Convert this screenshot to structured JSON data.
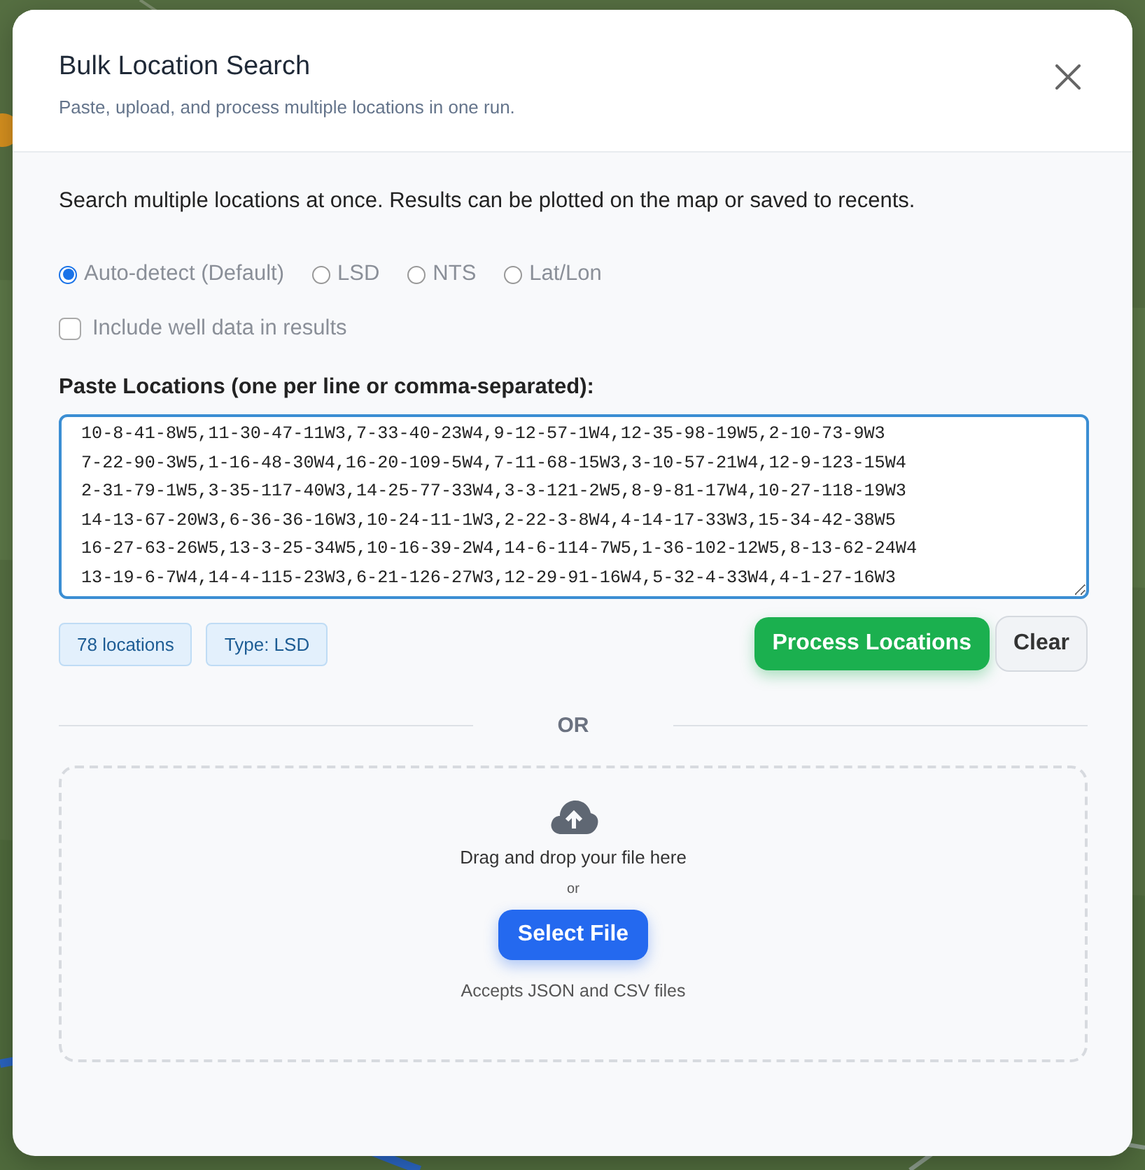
{
  "dialog": {
    "title": "Bulk Location Search",
    "subtitle": "Paste, upload, and process multiple locations in one run."
  },
  "intro": "Search multiple locations at once. Results can be plotted on the map or saved to recents.",
  "formats": [
    {
      "label": "Auto-detect (Default)",
      "selected": true
    },
    {
      "label": "LSD",
      "selected": false
    },
    {
      "label": "NTS",
      "selected": false
    },
    {
      "label": "Lat/Lon",
      "selected": false
    }
  ],
  "include_well_data": {
    "label": "Include well data in results",
    "checked": false
  },
  "paste": {
    "label": "Paste Locations (one per line or comma-separated):",
    "lines": [
      "10-8-41-8W5,11-30-47-11W3,7-33-40-23W4,9-12-57-1W4,12-35-98-19W5,2-10-73-9W3",
      "7-22-90-3W5,1-16-48-30W4,16-20-109-5W4,7-11-68-15W3,3-10-57-21W4,12-9-123-15W4",
      "2-31-79-1W5,3-35-117-40W3,14-25-77-33W4,3-3-121-2W5,8-9-81-17W4,10-27-118-19W3",
      "14-13-67-20W3,6-36-36-16W3,10-24-11-1W3,2-22-3-8W4,4-14-17-33W3,15-34-42-38W5",
      "16-27-63-26W5,13-3-25-34W5,10-16-39-2W4,14-6-114-7W5,1-36-102-12W5,8-13-62-24W4",
      "13-19-6-7W4,14-4-115-23W3,6-21-126-27W3,12-29-91-16W4,5-32-4-33W4,4-1-27-16W3"
    ]
  },
  "badges": [
    "78 locations",
    "Type: LSD"
  ],
  "buttons": {
    "process": "Process Locations",
    "clear": "Clear"
  },
  "divider": "OR",
  "upload": {
    "prompt": "Drag and drop your file here",
    "or": "or",
    "button": "Select File",
    "hint": "Accepts JSON and CSV files"
  }
}
